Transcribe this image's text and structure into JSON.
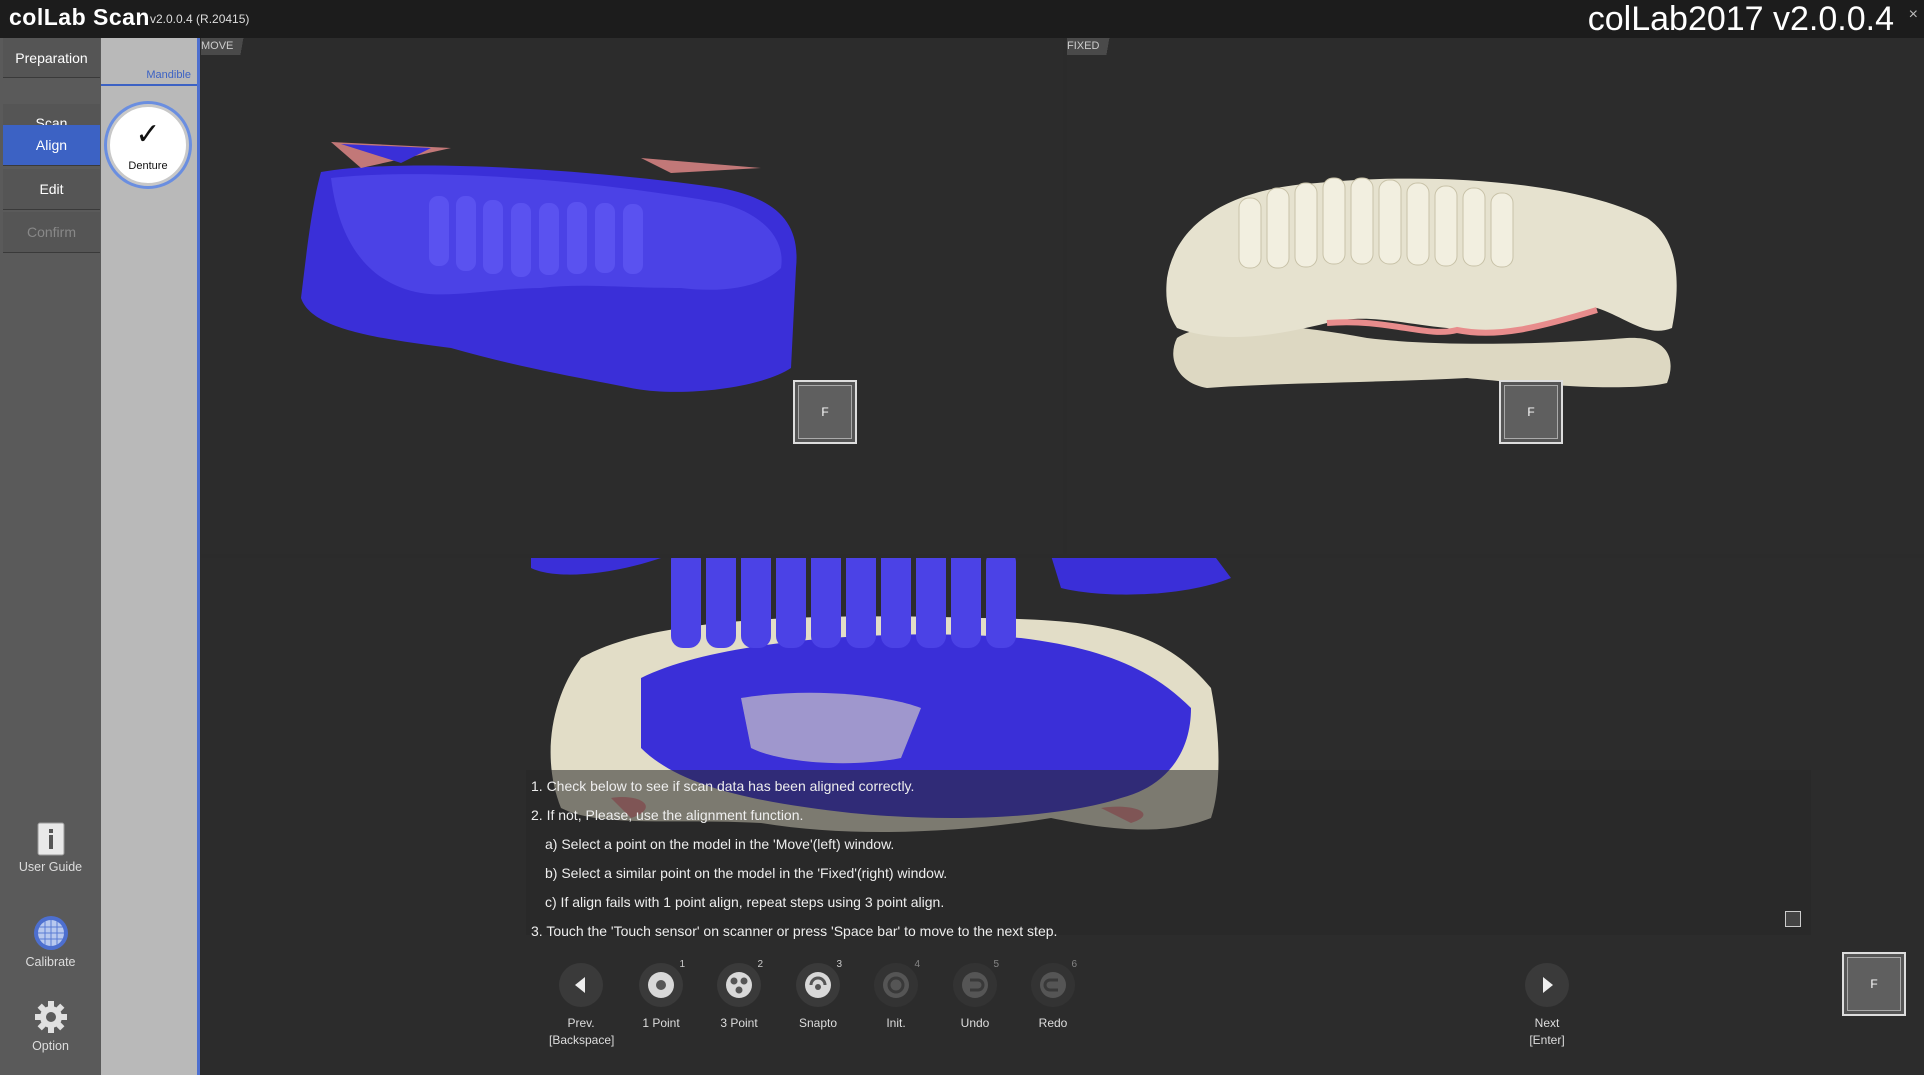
{
  "titlebar": {
    "app_title": "colLab Scan",
    "app_version": "v2.0.0.4  (R.20415)",
    "brand_version": "colLab2017 v2.0.0.4",
    "close_glyph": "×"
  },
  "nav": {
    "items": [
      {
        "label": "Preparation",
        "state": "normal"
      },
      {
        "label": "Scan",
        "state": "normal"
      },
      {
        "label": "Align",
        "state": "active"
      },
      {
        "label": "Edit",
        "state": "normal"
      },
      {
        "label": "Confirm",
        "state": "disabled"
      }
    ],
    "user_guide": "User Guide",
    "calibrate": "Calibrate",
    "option": "Option"
  },
  "subpanel": {
    "tab_label": "Mandible",
    "check_glyph": "✓",
    "denture_label": "Denture"
  },
  "viewports": {
    "move_label": "MOVE",
    "fixed_label": "FIXED",
    "f_button": "F"
  },
  "instructions": [
    "1. Check below to see if scan data has been aligned correctly.",
    "2. If not, Please, use the alignment function.",
    "a) Select a point on the model in the 'Move'(left) window.",
    "b) Select a similar point on the model in the 'Fixed'(right) window.",
    "c) If align fails with 1 point align, repeat steps using 3 point align.",
    "3. Touch the 'Touch sensor' on scanner or press 'Space bar' to move to the next step."
  ],
  "toolbar": {
    "prev_label": "Prev.",
    "prev_key": "[Backspace]",
    "tools": [
      {
        "label": "1 Point",
        "num": "1"
      },
      {
        "label": "3 Point",
        "num": "2"
      },
      {
        "label": "Snapto",
        "num": "3"
      },
      {
        "label": "Init.",
        "num": "4"
      },
      {
        "label": "Undo",
        "num": "5"
      },
      {
        "label": "Redo",
        "num": "6"
      }
    ],
    "next_label": "Next",
    "next_key": "[Enter]"
  },
  "colors": {
    "accent": "#3c62c4",
    "move_model": "#3a2fd8",
    "fixed_model": "#e6e2cf",
    "gum": "#e88c8c"
  }
}
